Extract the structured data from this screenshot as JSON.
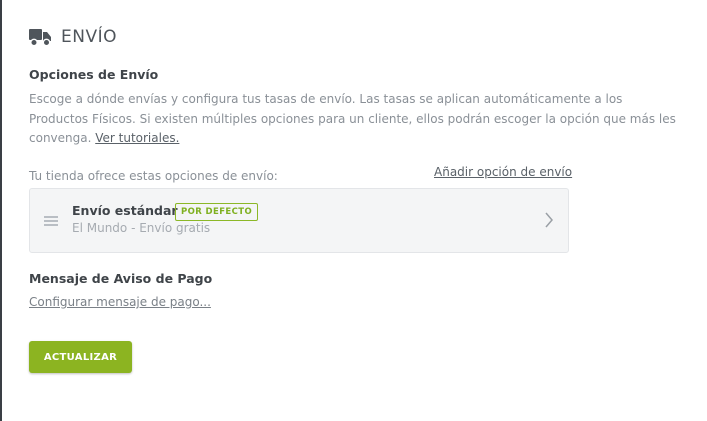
{
  "section": {
    "icon": "truck-icon",
    "title": "ENVÍO"
  },
  "options": {
    "title": "Opciones de Envío",
    "description_1": "Escoge a dónde envías y configura tus tasas de envío. Las tasas se aplican automáticamente a los Productos Físicos. Si existen múltiples opciones para un cliente, ellos podrán escoger la opción que más les convenga. ",
    "tutorials_link": "Ver tutoriales.",
    "offer_label": "Tu tienda ofrece estas opciones de envío:",
    "add_link": "Añadir opción de envío"
  },
  "methods": [
    {
      "name": "Envío estándar",
      "badge": "POR DEFECTO",
      "detail": "El Mundo - Envío gratis"
    }
  ],
  "payment_message": {
    "title": "Mensaje de Aviso de Pago",
    "config_link": "Configurar mensaje de pago..."
  },
  "actions": {
    "update_label": "ACTUALIZAR"
  },
  "colors": {
    "accent": "#8cb421",
    "badge": "#7fb020"
  }
}
